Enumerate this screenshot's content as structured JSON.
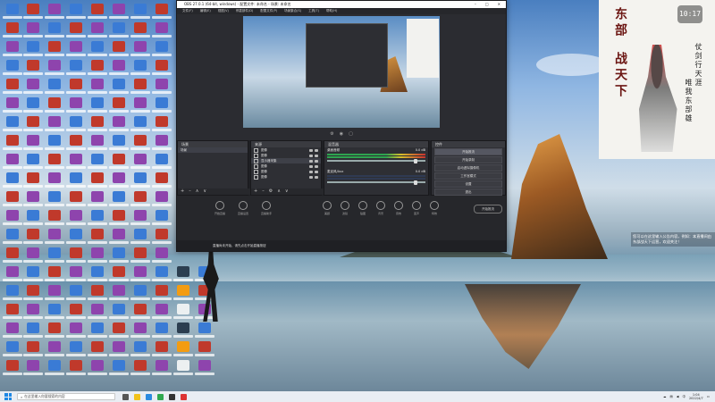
{
  "obs": {
    "title": "OBS 27.0.1 (64-bit, windows) - 配置文件: 未命名 - 场景: 未命名",
    "menu": [
      "文件(F)",
      "编辑(E)",
      "视图(V)",
      "停靠部件(D)",
      "配置文件(P)",
      "场景集合(S)",
      "工具(T)",
      "帮助(H)"
    ],
    "scenes_panel": {
      "header": "场景",
      "items": [
        "场景"
      ]
    },
    "sources_panel": {
      "header": "来源",
      "items": [
        "图像",
        "图像",
        "显示器采集",
        "图像",
        "图像",
        "图像"
      ]
    },
    "mixer_panel": {
      "header": "混音器",
      "channels": [
        {
          "name": "桌面音频",
          "db": "0.0 dB"
        },
        {
          "name": "麦克风/Aux",
          "db": "0.0 dB"
        }
      ]
    },
    "controls_panel": {
      "header": "控件",
      "buttons": [
        "开始推流",
        "开始录制",
        "启动虚拟摄像机",
        "工作室模式",
        "设置",
        "退出"
      ]
    },
    "dock_tabs": [
      "场景转场",
      "场景"
    ],
    "bottom_buttons": [
      "美颜",
      "滤镜",
      "贴图",
      "背景",
      "音效",
      "变声",
      "特效"
    ],
    "bottom_left": [
      "开始直播",
      "直播设置",
      "直播助手"
    ],
    "status_text": "直播尚未开始，请先点击开始直播按钮",
    "right_button": "开始推流"
  },
  "poster": {
    "clock": "10:17",
    "title_chars": [
      "东",
      "部",
      "战",
      "天",
      "下"
    ],
    "side_text": [
      "仗剑行天涯",
      "唯我东部雄"
    ]
  },
  "poster_caption": "您可以在这里输入公告内容，例如：本直播间由东部战天下运营，欢迎关注！",
  "taskbar": {
    "search_placeholder": "在这里输入你要搜索的内容",
    "time": "1:04",
    "date": "2022/4/7",
    "tray_label": "中"
  }
}
